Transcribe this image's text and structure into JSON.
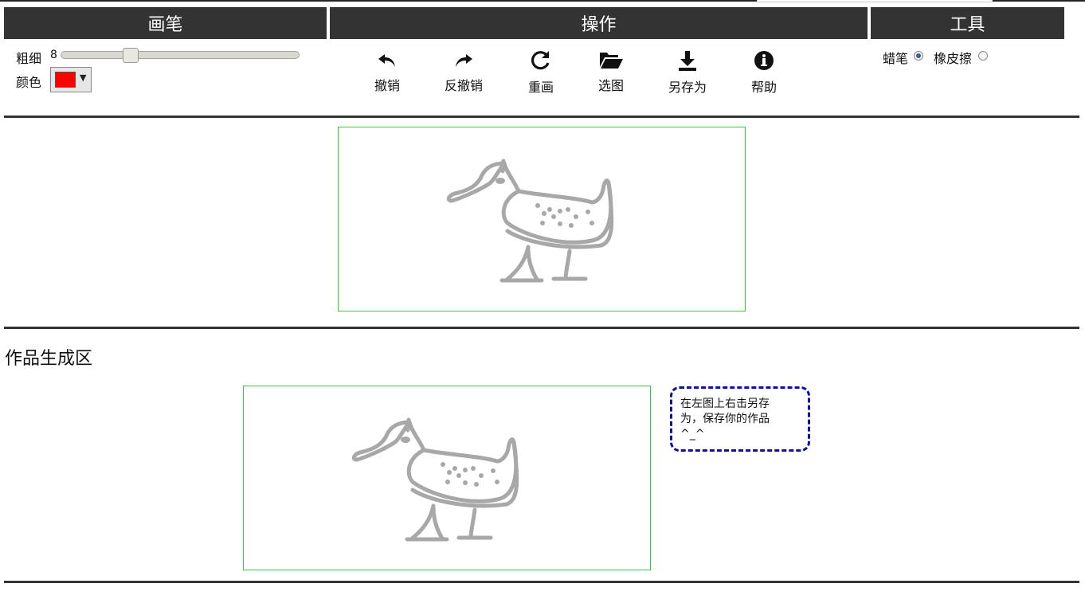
{
  "headers": {
    "brush": "画笔",
    "operations": "操作",
    "tools": "工具"
  },
  "brush": {
    "thickness_label": "粗细",
    "thickness_value": "8",
    "thickness_fraction": 0.28,
    "color_label": "颜色",
    "color_value": "#ff0000"
  },
  "operations": [
    {
      "label": "撤销",
      "icon": "undo-icon"
    },
    {
      "label": "反撤销",
      "icon": "redo-icon"
    },
    {
      "label": "重画",
      "icon": "refresh-icon"
    },
    {
      "label": "选图",
      "icon": "folder-open-icon"
    },
    {
      "label": "另存为",
      "icon": "download-icon"
    },
    {
      "label": "帮助",
      "icon": "info-icon"
    }
  ],
  "tools": {
    "crayon_label": "蜡笔",
    "crayon_checked": true,
    "eraser_label": "橡皮擦",
    "eraser_checked": false
  },
  "output": {
    "section_title": "作品生成区",
    "tip_text": "在左图上右击另存为，保存你的作品^_^"
  },
  "colors": {
    "header_bg": "#333333",
    "canvas_border": "#2ecc40",
    "drawing_stroke": "#a8a8a8",
    "tip_border": "#1010a0"
  }
}
